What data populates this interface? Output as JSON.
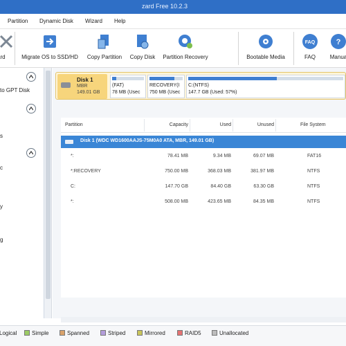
{
  "window": {
    "title": "zard Free 10.2.3"
  },
  "menu": [
    "Partition",
    "Dynamic Disk",
    "Wizard",
    "Help"
  ],
  "toolbar": [
    {
      "label": "ard",
      "icon": "wizard-icon"
    },
    {
      "label": "Migrate OS to SSD/HD",
      "icon": "migrate-icon"
    },
    {
      "label": "Copy Partition",
      "icon": "copy-partition-icon"
    },
    {
      "label": "Copy Disk",
      "icon": "copy-disk-icon"
    },
    {
      "label": "Partition Recovery",
      "icon": "partition-recovery-icon"
    },
    {
      "label": "Bootable Media",
      "icon": "bootable-media-icon"
    },
    {
      "label": "FAQ",
      "icon": "faq-icon"
    },
    {
      "label": "Manua",
      "icon": "manual-icon"
    }
  ],
  "sidebar": {
    "items": [
      "to GPT Disk",
      "s",
      "c",
      "y",
      "g"
    ]
  },
  "disk_map": {
    "disk_name": "Disk 1",
    "disk_type": "MBR",
    "disk_size": "149.01 GB",
    "partitions": [
      {
        "line1": "(FAT)",
        "line2": "78 MB (Usec",
        "used_fraction": 0.12
      },
      {
        "line1": "RECOVERY(I",
        "line2": "750 MB (Usec",
        "used_fraction": 0.74
      },
      {
        "line1": "C:(NTFS)",
        "line2": "147.7 GB (Used: 57%)",
        "used_fraction": 0.57
      }
    ]
  },
  "table": {
    "columns": [
      "Partition",
      "Capacity",
      "Used",
      "Unused",
      "File System"
    ],
    "disk_row": "Disk 1 (WDC WD1600AAJS-75M0A0 ATA, MBR, 149.01 GB)",
    "rows": [
      [
        "*:",
        "78.41 MB",
        "9.34 MB",
        "69.07 MB",
        "FAT16"
      ],
      [
        "*:RECOVERY",
        "750.00 MB",
        "368.03 MB",
        "381.97 MB",
        "NTFS"
      ],
      [
        "C:",
        "147.70 GB",
        "84.40 GB",
        "63.30 GB",
        "NTFS"
      ],
      [
        "*:",
        "508.00 MB",
        "423.65 MB",
        "84.35 MB",
        "NTFS"
      ]
    ]
  },
  "legend": [
    {
      "label": "Logical",
      "color": "#4a8fd6"
    },
    {
      "label": "Simple",
      "color": "#9ccc65"
    },
    {
      "label": "Spanned",
      "color": "#d9a26b"
    },
    {
      "label": "Striped",
      "color": "#b39ddb"
    },
    {
      "label": "Mirrored",
      "color": "#c9c55b"
    },
    {
      "label": "RAID5",
      "color": "#e57373"
    },
    {
      "label": "Unallocated",
      "color": "#bdbdbd"
    }
  ]
}
